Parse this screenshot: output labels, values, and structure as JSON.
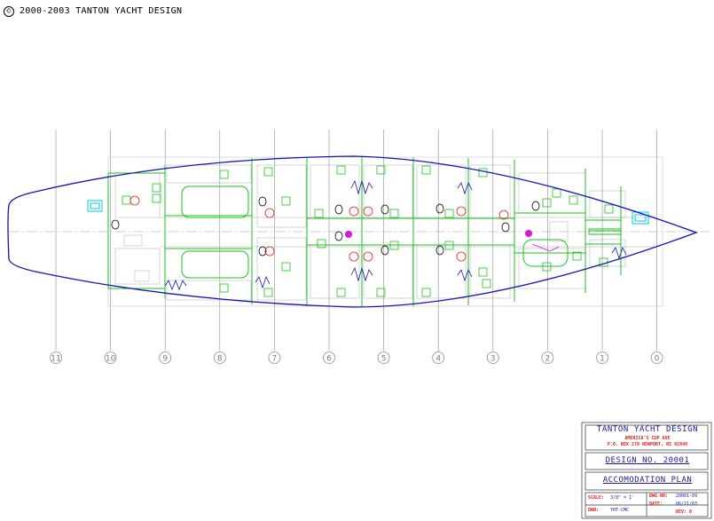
{
  "copyright": "2000-2003 TANTON YACHT DESIGN",
  "copyright_symbol": "©",
  "stations": [
    "11",
    "10",
    "9",
    "8",
    "7",
    "6",
    "5",
    "4",
    "3",
    "2",
    "1",
    "0"
  ],
  "title_block": {
    "firm": "TANTON YACHT DESIGN",
    "address_line1": "AMERICA'S CUP AVE",
    "address_line2": "P.O. BOX 270 NEWPORT, RI 02840",
    "design_no": "DESIGN NO. 20001",
    "drawing_title": "ACCOMODATION PLAN",
    "scale_label": "SCALE:",
    "scale_value": "3/8\" = 1'",
    "dwn_label": "DWN:",
    "dwn_value": "YHT-CMC",
    "dwg_label": "DWG NO:",
    "dwg_value": "20001-09",
    "date_label": "DATE:",
    "date_value": "06/21/03",
    "rev_value": "REV: 0"
  },
  "colors": {
    "hull": "#1414b4",
    "partition": "#1cc21c",
    "detail": "#7f7f7f",
    "station_line": "#8c8c8c",
    "title_red": "#e0201e",
    "title_blue": "#1a1aa6",
    "hatch": "#00c8e6",
    "accent": "#d81ad8"
  }
}
